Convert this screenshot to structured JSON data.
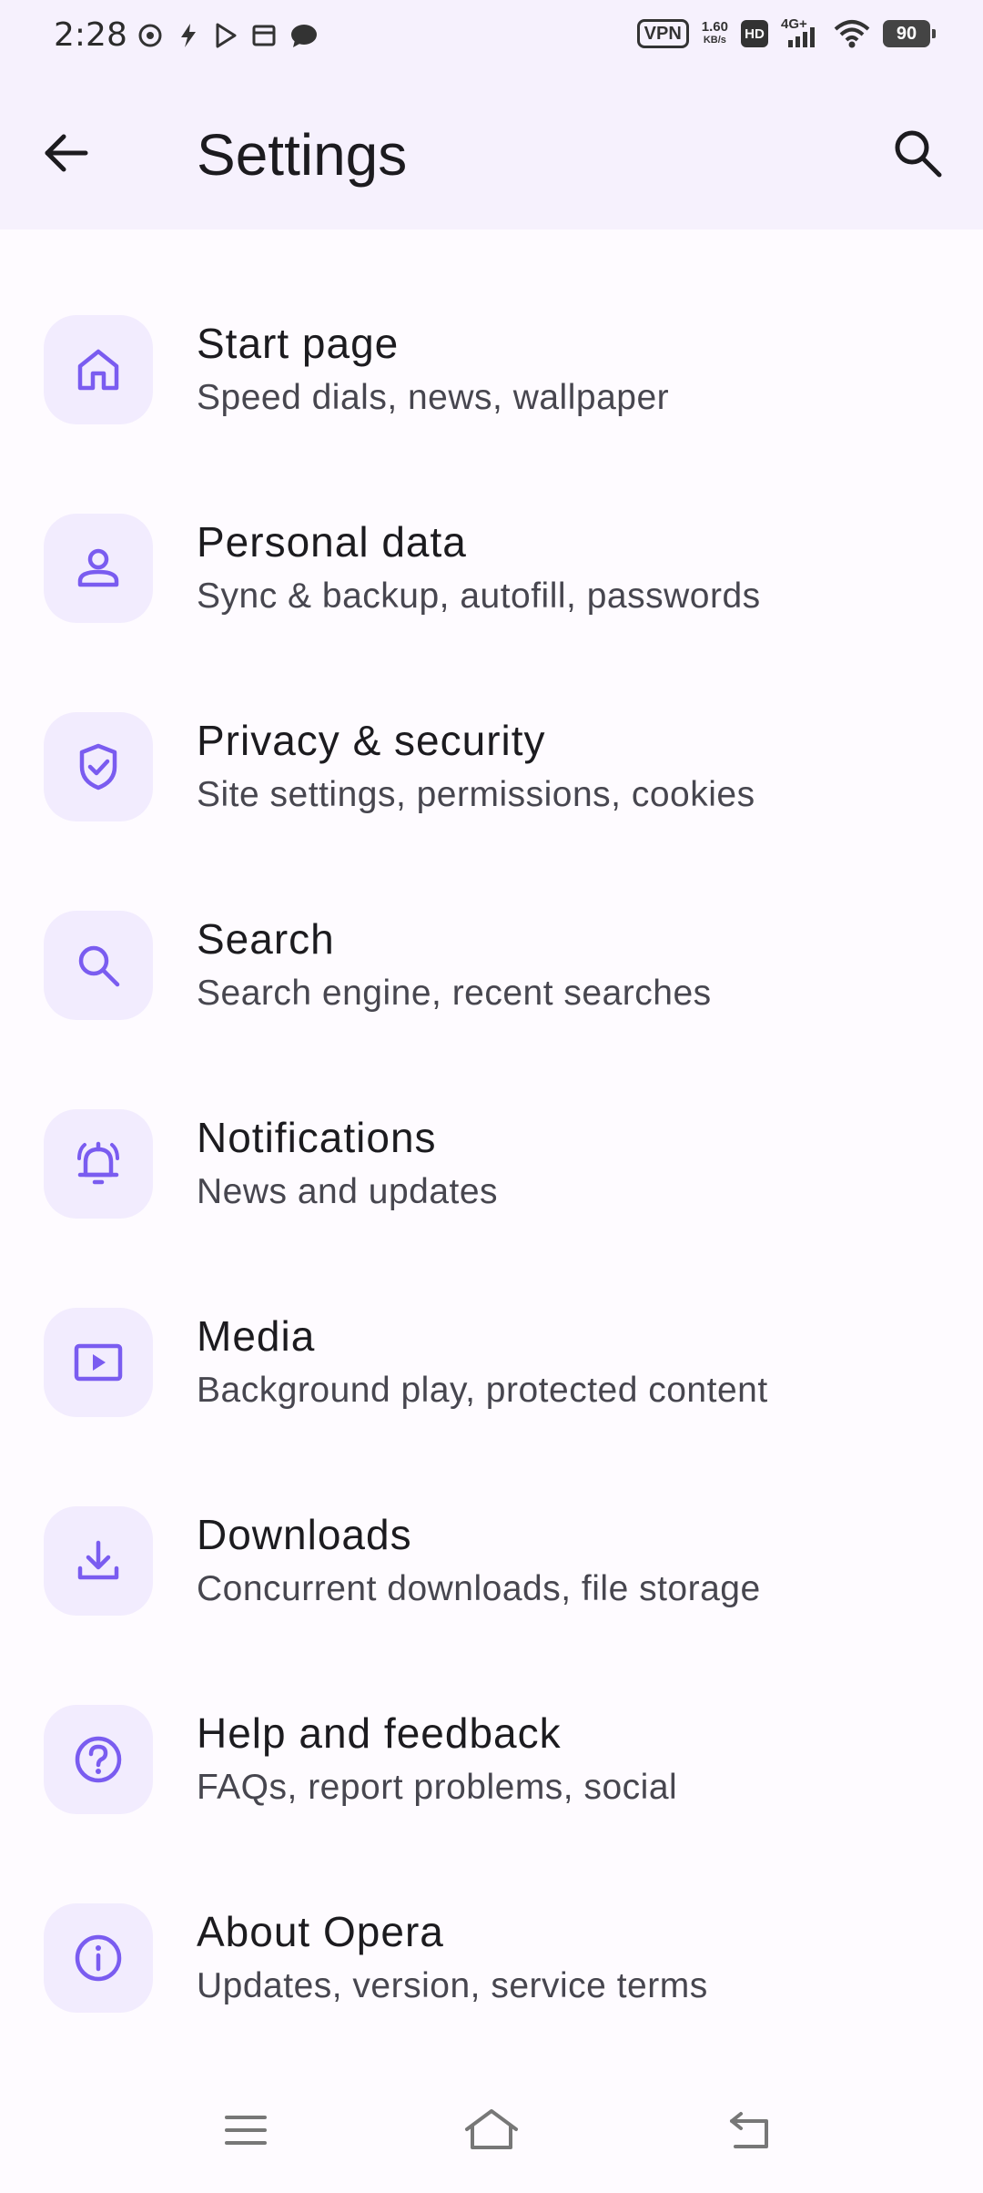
{
  "status_bar": {
    "time": "2:28",
    "vpn": "VPN",
    "net_speed_value": "1.60",
    "net_speed_unit": "KB/s",
    "hd": "HD",
    "network": "4G+",
    "battery": "90"
  },
  "app_bar": {
    "title": "Settings",
    "back_icon": "arrow-left-icon",
    "search_icon": "search-icon"
  },
  "settings": [
    {
      "title": "Start page",
      "subtitle": "Speed dials, news, wallpaper",
      "icon": "home-icon"
    },
    {
      "title": "Personal data",
      "subtitle": "Sync & backup, autofill, passwords",
      "icon": "person-icon"
    },
    {
      "title": "Privacy & security",
      "subtitle": "Site settings, permissions, cookies",
      "icon": "shield-check-icon"
    },
    {
      "title": "Search",
      "subtitle": "Search engine, recent searches",
      "icon": "search-icon"
    },
    {
      "title": "Notifications",
      "subtitle": "News and updates",
      "icon": "bell-ringing-icon"
    },
    {
      "title": "Media",
      "subtitle": "Background play, protected content",
      "icon": "play-box-icon"
    },
    {
      "title": "Downloads",
      "subtitle": "Concurrent downloads, file storage",
      "icon": "download-icon"
    },
    {
      "title": "Help and feedback",
      "subtitle": "FAQs, report problems, social",
      "icon": "help-circle-icon"
    },
    {
      "title": "About Opera",
      "subtitle": "Updates, version, service terms",
      "icon": "info-circle-icon"
    }
  ],
  "colors": {
    "accent": "#7a5cf0",
    "icon_bg": "#f2ecfe",
    "app_bar_bg": "#f6f1fd",
    "page_bg": "#fefbff"
  }
}
